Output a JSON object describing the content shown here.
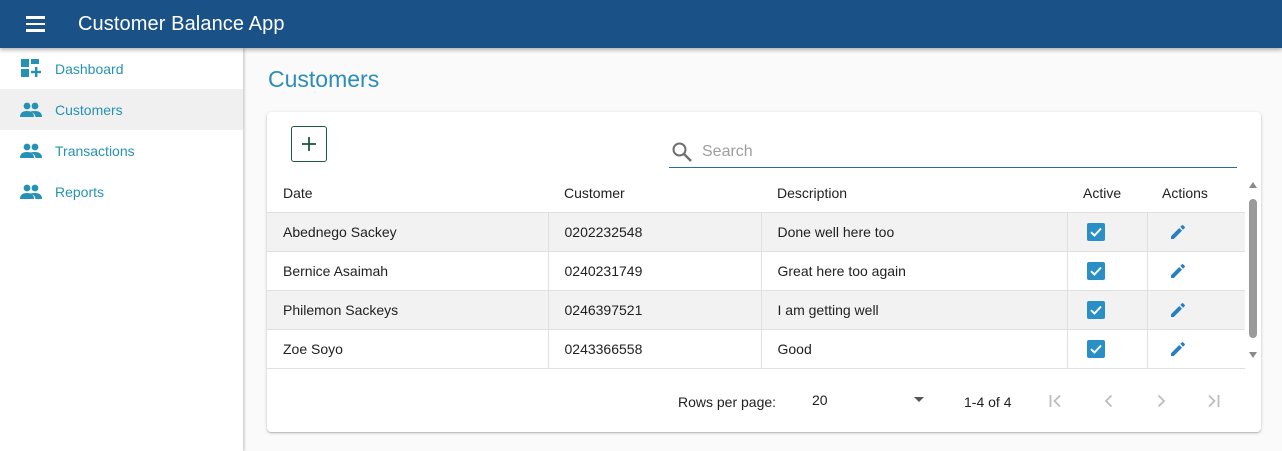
{
  "app": {
    "title": "Customer Balance App"
  },
  "sidebar": {
    "items": [
      {
        "label": "Dashboard",
        "icon": "dashboard-add-icon"
      },
      {
        "label": "Customers",
        "icon": "people-icon",
        "active": true
      },
      {
        "label": "Transactions",
        "icon": "people-icon"
      },
      {
        "label": "Reports",
        "icon": "people-icon"
      }
    ]
  },
  "page": {
    "title": "Customers"
  },
  "toolbar": {
    "add_icon": "plus-icon"
  },
  "search": {
    "placeholder": "Search",
    "value": ""
  },
  "table": {
    "columns": [
      "Date",
      "Customer",
      "Description",
      "Active",
      "Actions"
    ],
    "rows": [
      {
        "date": "Abednego Sackey",
        "customer": "0202232548",
        "description": "Done well here too",
        "active": true
      },
      {
        "date": "Bernice Asaimah",
        "customer": "0240231749",
        "description": "Great here too again",
        "active": true
      },
      {
        "date": "Philemon Sackeys",
        "customer": "0246397521",
        "description": "I am getting well",
        "active": true
      },
      {
        "date": "Zoe Soyo",
        "customer": "0243366558",
        "description": "Good",
        "active": true
      }
    ]
  },
  "pagination": {
    "rows_per_page_label": "Rows per page:",
    "rows_per_page_value": "20",
    "range": "1-4 of 4"
  },
  "colors": {
    "appbar": "#1a5186",
    "accent": "#2b8eb8",
    "checkbox": "#2a8fc5"
  }
}
